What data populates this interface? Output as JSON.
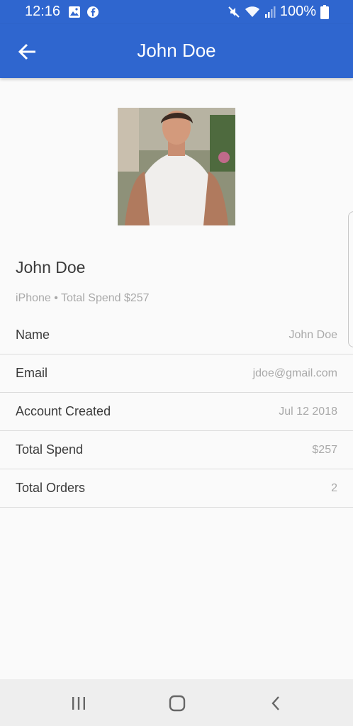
{
  "status_bar": {
    "time": "12:16",
    "battery": "100%",
    "icons": [
      "image-icon",
      "facebook-icon",
      "mute-icon",
      "wifi-icon",
      "signal-icon",
      "battery-icon"
    ]
  },
  "app_bar": {
    "title": "John Doe",
    "back_icon": "arrow-left-icon"
  },
  "profile": {
    "name": "John Doe",
    "subtitle": "iPhone • Total Spend $257"
  },
  "details": [
    {
      "label": "Name",
      "value": "John Doe"
    },
    {
      "label": "Email",
      "value": "jdoe@gmail.com"
    },
    {
      "label": "Account Created",
      "value": "Jul 12 2018"
    },
    {
      "label": "Total Spend",
      "value": "$257"
    },
    {
      "label": "Total Orders",
      "value": "2"
    }
  ],
  "nav_bar": {
    "icons": [
      "recent-apps-icon",
      "home-icon",
      "back-icon"
    ]
  },
  "colors": {
    "primary": "#2f66cf",
    "background": "#fafafa",
    "text_primary": "#3a3a3a",
    "text_secondary": "#a9a9a9",
    "divider": "#dcdcdc"
  }
}
